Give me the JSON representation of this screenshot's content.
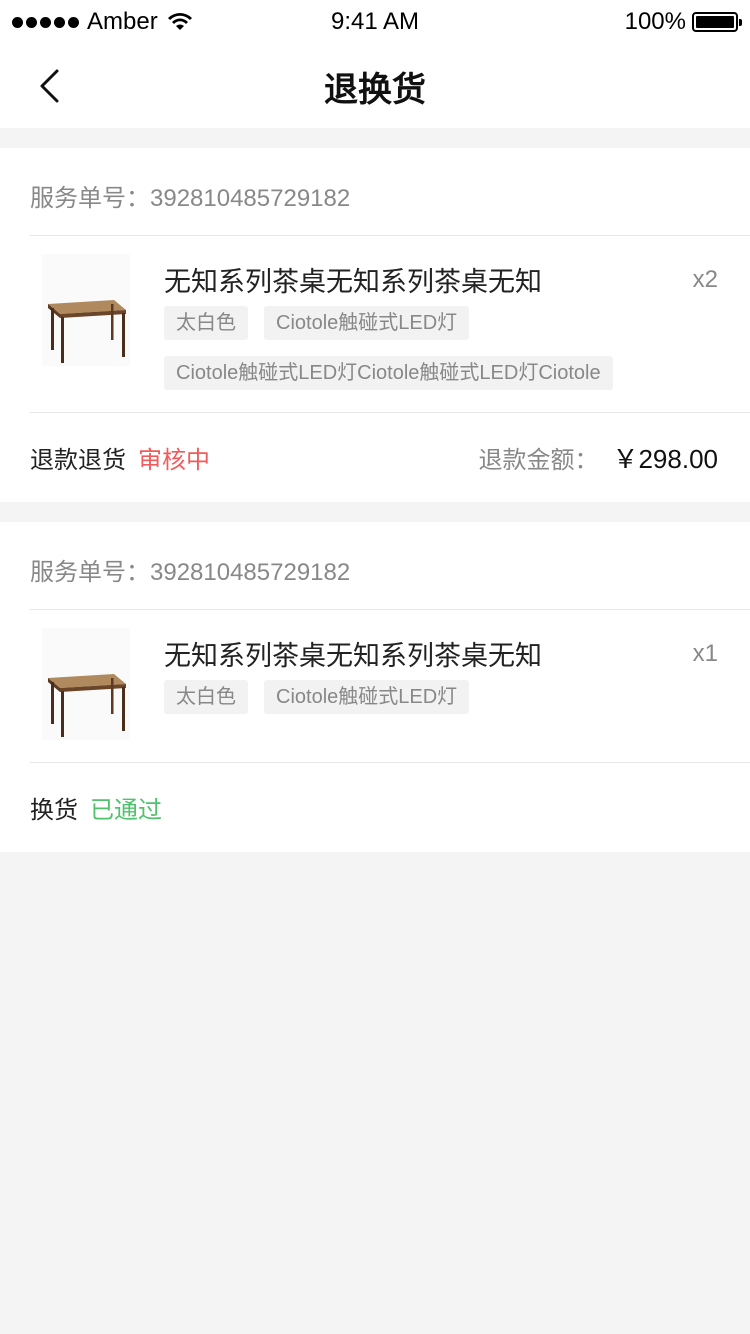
{
  "status_bar": {
    "carrier": "Amber",
    "time": "9:41 AM",
    "battery": "100%"
  },
  "nav": {
    "title": "退换货"
  },
  "orders": [
    {
      "order_label": "服务单号：392810485729182",
      "product_name": "无知系列茶桌无知系列茶桌无知",
      "quantity": "x2",
      "tags": [
        "太白色",
        "Ciotole触碰式LED灯",
        "Ciotole触碰式LED灯Ciotole触碰式LED灯Ciotole"
      ],
      "service_type": "退款退货",
      "status": "审核中",
      "refund_label": "退款金额：",
      "refund_amount": "￥298.00"
    },
    {
      "order_label": "服务单号：392810485729182",
      "product_name": "无知系列茶桌无知系列茶桌无知",
      "quantity": "x1",
      "tags": [
        "太白色",
        "Ciotole触碰式LED灯"
      ],
      "service_type": "换货",
      "status": "已通过"
    }
  ],
  "colors": {
    "status_pending": "#f25b5b",
    "status_approved": "#4fc26b"
  }
}
